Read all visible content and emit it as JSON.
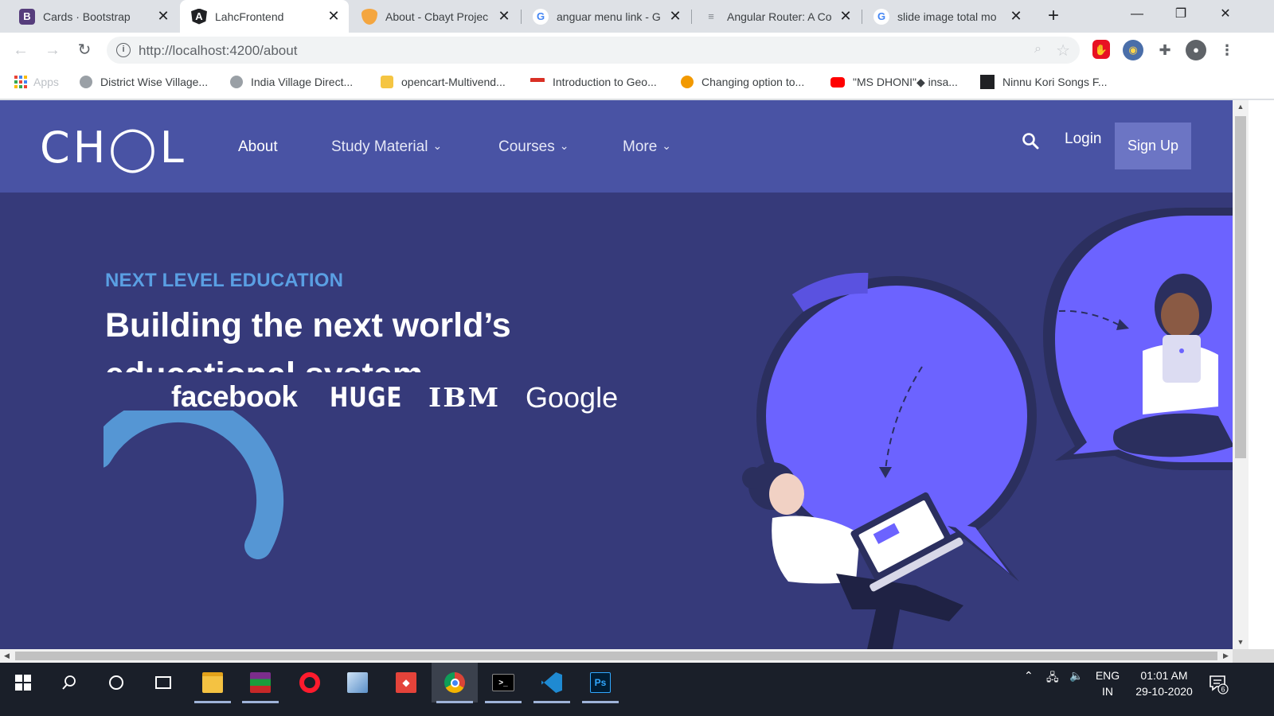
{
  "browser": {
    "tabs": [
      {
        "title": "Cards · Bootstrap",
        "icon": "bootstrap-icon",
        "icon_text": "B",
        "icon_bg": "#563d7c",
        "active": false
      },
      {
        "title": "LahcFrontend",
        "icon": "angular-icon",
        "icon_text": "A",
        "icon_bg": "#202124",
        "active": true
      },
      {
        "title": "About - Cbayt Projec",
        "icon": "site-icon",
        "icon_text": "",
        "icon_bg": "#f4a640",
        "active": false
      },
      {
        "title": "anguar menu link - G",
        "icon": "google-icon",
        "icon_text": "G",
        "icon_bg": "#ffffff",
        "active": false
      },
      {
        "title": "Angular Router: A Co",
        "icon": "doc-icon",
        "icon_text": "≡",
        "icon_bg": "#dee1e6",
        "active": false
      },
      {
        "title": "slide image total mo",
        "icon": "google-icon",
        "icon_text": "G",
        "icon_bg": "#ffffff",
        "active": false
      }
    ],
    "close_glyph": "✕",
    "new_tab_glyph": "+",
    "window_controls": {
      "minimize": "—",
      "restore": "❐",
      "close": "✕"
    },
    "url": "http://localhost:4200/about",
    "bookmarks": [
      {
        "label": "Apps",
        "icon": "apps-grid-icon"
      },
      {
        "label": "District Wise Village...",
        "icon": "globe-icon",
        "color": "#9aa0a6"
      },
      {
        "label": "India Village Direct...",
        "icon": "globe-icon",
        "color": "#9aa0a6"
      },
      {
        "label": "opencart-Multivend...",
        "icon": "opencart-icon",
        "color": "#f5c542"
      },
      {
        "label": "Introduction to Geo...",
        "icon": "flag-icon",
        "color": "#d93025"
      },
      {
        "label": "Changing option to...",
        "icon": "cloud-icon",
        "color": "#f29900"
      },
      {
        "label": "\"MS DHONI\"◆ insa...",
        "icon": "youtube-icon",
        "color": "#ff0000"
      },
      {
        "label": "Ninnu Kori Songs F...",
        "icon": "film-icon",
        "color": "#202124"
      }
    ]
  },
  "site": {
    "logo": "CH◯L",
    "nav": {
      "about": "About",
      "study_material": "Study Material",
      "courses": "Courses",
      "more": "More",
      "login": "Login",
      "signup": "Sign Up"
    },
    "hero": {
      "eyebrow": "NEXT LEVEL EDUCATION",
      "title": "Building the next world’s educational system"
    },
    "brands": {
      "facebook": "facebook",
      "huge": "HUGE",
      "ibm": "IBM",
      "google": "Google"
    },
    "colors": {
      "nav_bg": "#4953a4",
      "hero_bg": "#363a7a",
      "accent_blue": "#5a9fe3",
      "bubble": "#6c63ff"
    }
  },
  "taskbar": {
    "apps": [
      "start-icon",
      "search-icon",
      "cortana-icon",
      "task-view-icon",
      "file-explorer-icon",
      "winrar-icon",
      "opera-icon",
      "virtualbox-icon",
      "git-icon",
      "chrome-icon",
      "terminal-icon",
      "vscode-icon",
      "photoshop-icon"
    ],
    "photoshop_label": "Ps",
    "language": "ENG",
    "region": "IN",
    "time": "01:01 AM",
    "date": "29-10-2020",
    "notification_count": "6"
  }
}
